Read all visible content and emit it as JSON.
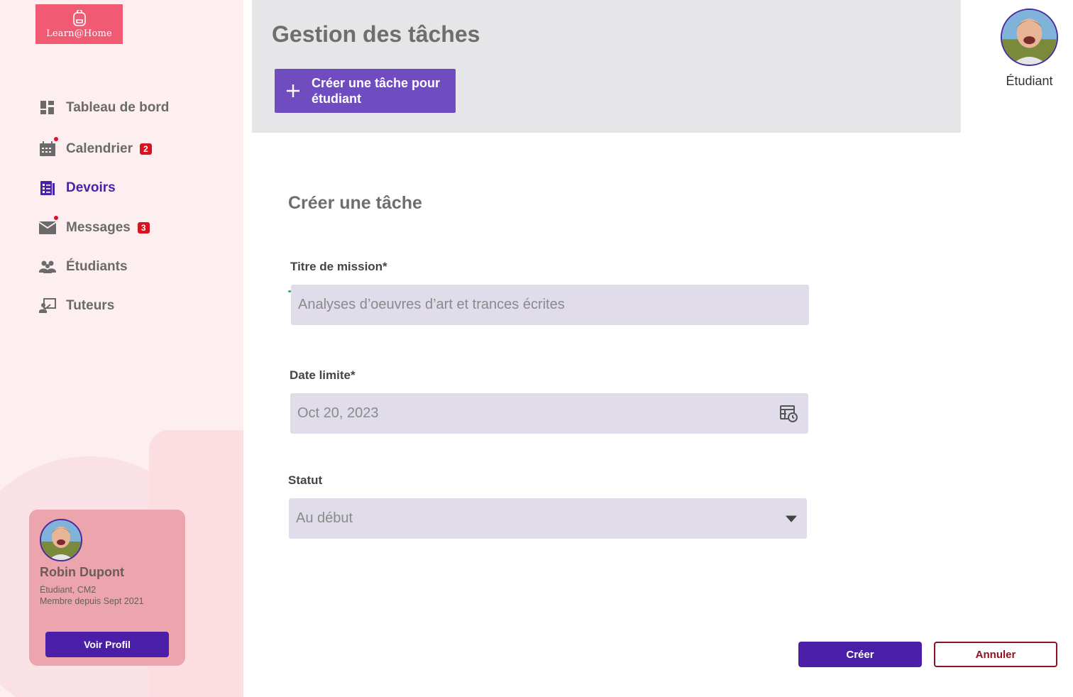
{
  "app": {
    "logo_text": "Learn@Home",
    "brand_color": "#f05a72",
    "accent_color": "#4a1ea6"
  },
  "sidebar": {
    "items": [
      {
        "label": "Tableau de bord",
        "icon": "dashboard-icon"
      },
      {
        "label": "Calendrier",
        "icon": "calendar-icon",
        "badge": "2"
      },
      {
        "label": "Devoirs",
        "icon": "assignments-icon",
        "active": true
      },
      {
        "label": "Messages",
        "icon": "mail-icon",
        "badge": "3"
      },
      {
        "label": "Étudiants",
        "icon": "students-icon"
      },
      {
        "label": "Tuteurs",
        "icon": "tutors-icon"
      }
    ],
    "profile": {
      "name": "Robin Dupont",
      "role": "Étudiant, CM2",
      "member_since": "Membre depuis Sept 2021",
      "button_label": "Voir Profil"
    }
  },
  "header": {
    "title": "Gestion des tâches",
    "create_button": "Créer une tâche pour étudiant",
    "user_role": "Étudiant"
  },
  "form": {
    "title": "Créer une tâche",
    "mission": {
      "label": "Titre de mission*",
      "placeholder": "Analyses d’oeuvres d’art et trances écrites"
    },
    "deadline": {
      "label": "Date limite*",
      "value": "Oct 20, 2023"
    },
    "status": {
      "label": "Statut",
      "value": "Au début"
    },
    "create_label": "Créer",
    "cancel_label": "Annuler"
  }
}
